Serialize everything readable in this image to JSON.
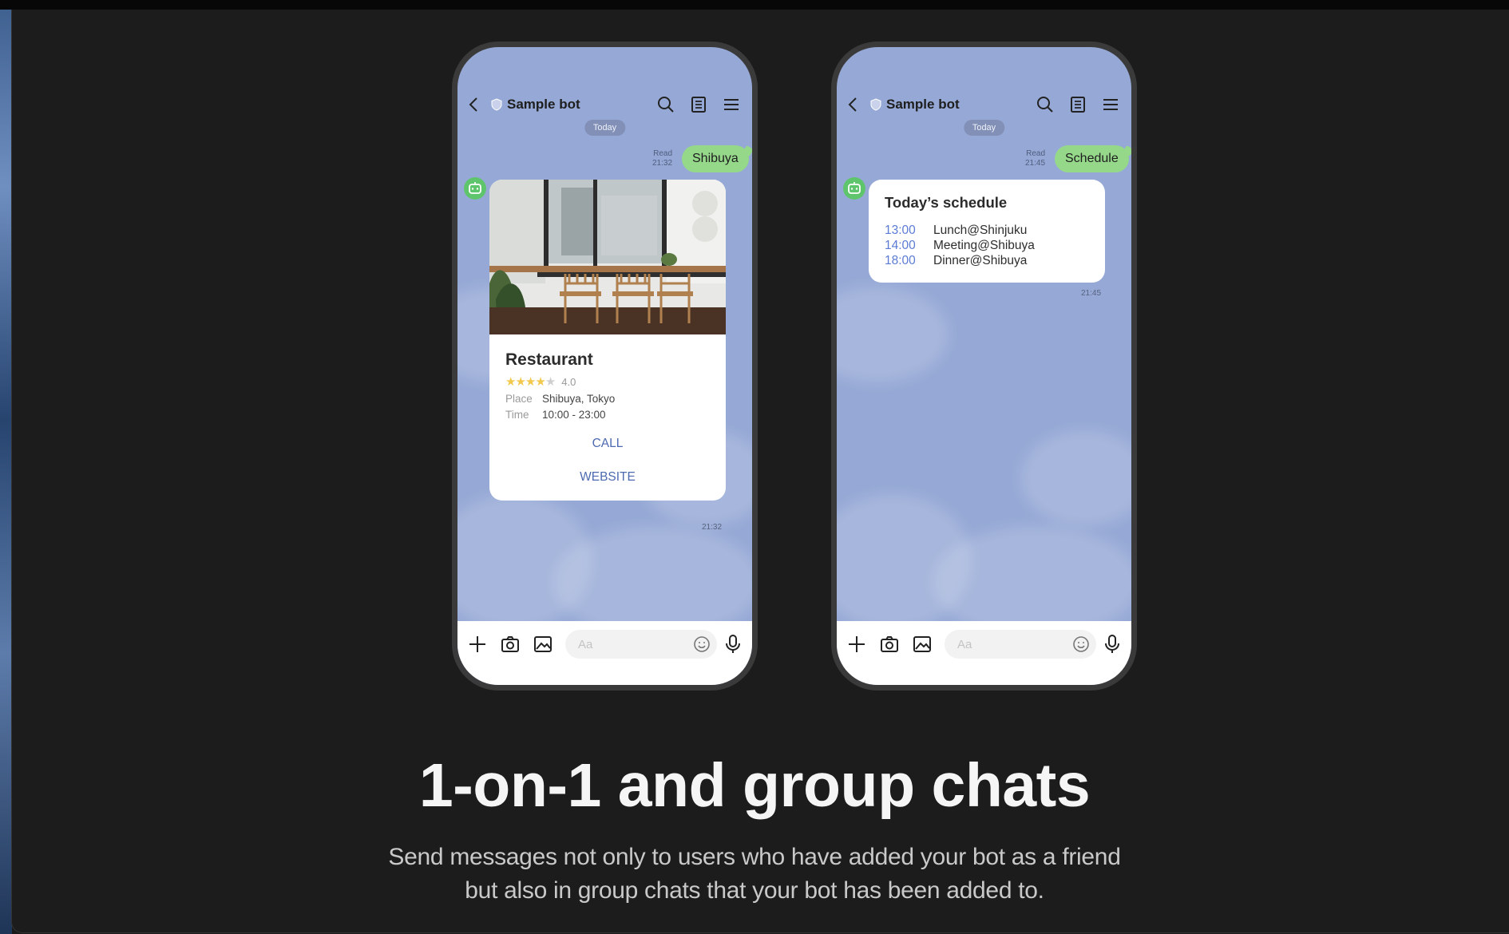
{
  "chat_common": {
    "bot_name": "Sample bot",
    "date_label": "Today",
    "read_label": "Read",
    "input_placeholder": "Aa"
  },
  "left_chat": {
    "sent_message": "Shibuya",
    "sent_time": "21:32",
    "card": {
      "title": "Restaurant",
      "rating": 4.0,
      "rating_text": "4.0",
      "place_label": "Place",
      "place_value": "Shibuya, Tokyo",
      "time_label": "Time",
      "time_value": "10:00 - 23:00",
      "call_label": "CALL",
      "website_label": "WEBSITE"
    },
    "card_time": "21:32"
  },
  "right_chat": {
    "sent_message": "Schedule",
    "sent_time": "21:45",
    "schedule": {
      "title": "Today’s schedule",
      "items": [
        {
          "time": "13:00",
          "event": "Lunch@Shinjuku"
        },
        {
          "time": "14:00",
          "event": "Meeting@Shibuya"
        },
        {
          "time": "18:00",
          "event": "Dinner@Shibuya"
        }
      ]
    },
    "card_time": "21:45"
  },
  "section": {
    "headline": "1-on-1 and group chats",
    "subtext_line1": "Send messages not only to users who have added your bot as a friend",
    "subtext_line2": "but also in group chats that your bot has been added to."
  },
  "colors": {
    "chat_background": "#96a9d6",
    "sent_bubble": "#95d88a",
    "link_blue": "#4d6ab0",
    "schedule_time": "#5b7bd5",
    "page_background": "#1c1c1c"
  }
}
